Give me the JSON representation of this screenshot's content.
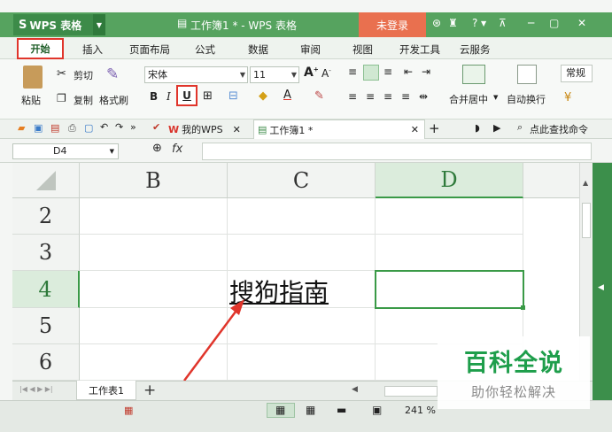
{
  "app": {
    "name": "WPS 表格",
    "doc_title": "工作簿1 * - WPS 表格",
    "login": "未登录",
    "help": "?"
  },
  "tabs": [
    {
      "label": "开始"
    },
    {
      "label": "插入"
    },
    {
      "label": "页面布局"
    },
    {
      "label": "公式"
    },
    {
      "label": "数据"
    },
    {
      "label": "审阅"
    },
    {
      "label": "视图"
    },
    {
      "label": "开发工具"
    },
    {
      "label": "云服务"
    }
  ],
  "ribbon": {
    "paste": "粘贴",
    "cut": "剪切",
    "copy": "复制",
    "format_painter": "格式刷",
    "font_name": "宋体",
    "font_size": "11",
    "bold": "B",
    "italic": "I",
    "underline": "U",
    "merge_center": "合并居中",
    "wrap_text": "自动换行",
    "number_format": "常规",
    "font_color_letter": "A"
  },
  "doc_tabs": {
    "wps": "我的WPS",
    "workbook": "工作簿1 *",
    "search": "点此查找命令"
  },
  "formula": {
    "name_box": "D4",
    "fx": "fx",
    "value": ""
  },
  "grid": {
    "columns": [
      "B",
      "C",
      "D"
    ],
    "rows": [
      "2",
      "3",
      "4",
      "5",
      "6"
    ],
    "cell_c4": "搜狗指南",
    "selected": "D4"
  },
  "sheets": {
    "tabs": [
      "工作表1"
    ],
    "add": "+"
  },
  "status": {
    "zoom": "241 %"
  },
  "watermark": {
    "title": "百科全说",
    "subtitle": "助你轻松解决"
  },
  "colors": {
    "brand": "#56a35f",
    "login": "#e9704f",
    "selection": "#3a9a47",
    "highlight": "#e0352b"
  }
}
